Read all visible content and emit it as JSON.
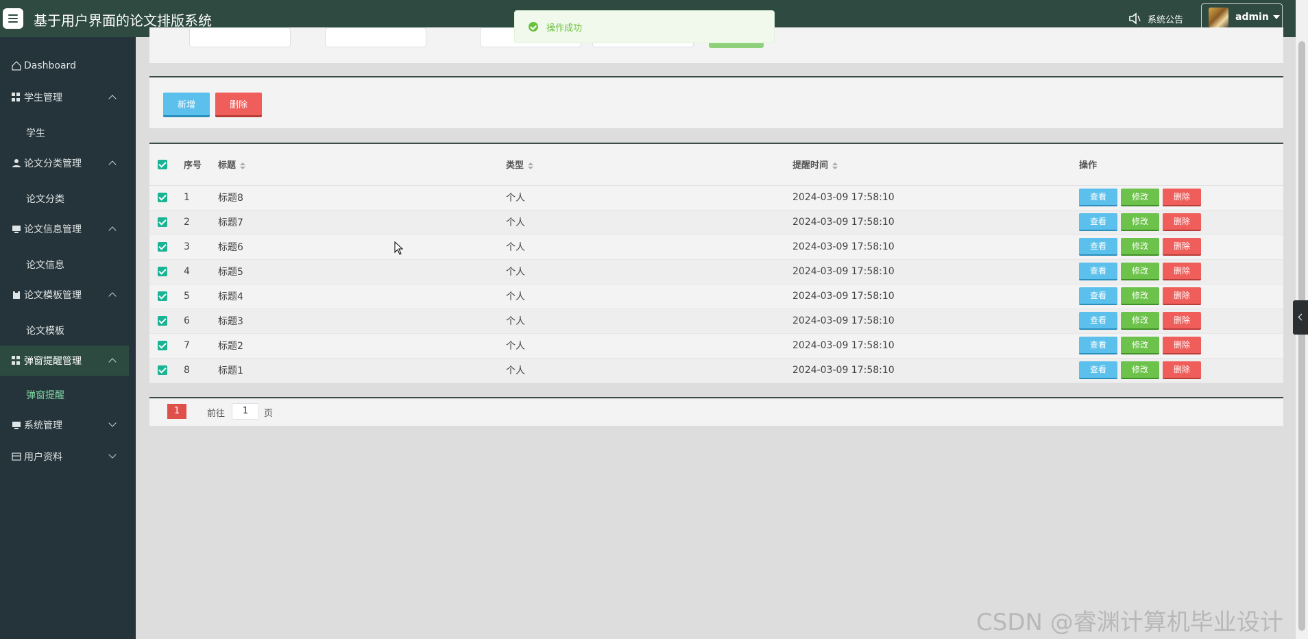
{
  "app": {
    "title": "基于用户界面的论文排版系统"
  },
  "header": {
    "notice_label": "系统公告",
    "user_name": "admin"
  },
  "toast": {
    "message": "操作成功"
  },
  "sidebar": {
    "dashboard": "Dashboard",
    "groups": [
      {
        "label": "学生管理",
        "sub": "学生"
      },
      {
        "label": "论文分类管理",
        "sub": "论文分类"
      },
      {
        "label": "论文信息管理",
        "sub": "论文信息"
      },
      {
        "label": "论文模板管理",
        "sub": "论文模板"
      },
      {
        "label": "弹窗提醒管理",
        "sub": "弹窗提醒"
      }
    ],
    "system": "系统管理",
    "profile": "用户资料"
  },
  "actions": {
    "add": "新增",
    "delete": "删除"
  },
  "table": {
    "headers": {
      "index": "序号",
      "title": "标题",
      "type": "类型",
      "time": "提醒时间",
      "ops": "操作"
    },
    "op_labels": {
      "view": "查看",
      "edit": "修改",
      "delete": "删除"
    },
    "rows": [
      {
        "index": "1",
        "title": "标题8",
        "type": "个人",
        "time": "2024-03-09 17:58:10"
      },
      {
        "index": "2",
        "title": "标题7",
        "type": "个人",
        "time": "2024-03-09 17:58:10"
      },
      {
        "index": "3",
        "title": "标题6",
        "type": "个人",
        "time": "2024-03-09 17:58:10"
      },
      {
        "index": "4",
        "title": "标题5",
        "type": "个人",
        "time": "2024-03-09 17:58:10"
      },
      {
        "index": "5",
        "title": "标题4",
        "type": "个人",
        "time": "2024-03-09 17:58:10"
      },
      {
        "index": "6",
        "title": "标题3",
        "type": "个人",
        "time": "2024-03-09 17:58:10"
      },
      {
        "index": "7",
        "title": "标题2",
        "type": "个人",
        "time": "2024-03-09 17:58:10"
      },
      {
        "index": "8",
        "title": "标题1",
        "type": "个人",
        "time": "2024-03-09 17:58:10"
      }
    ]
  },
  "pager": {
    "current": "1",
    "goto_label": "前往",
    "page_input": "1",
    "page_suffix": "页"
  },
  "watermark": "CSDN @睿渊计算机毕业设计",
  "colors": {
    "header_bg": "#2e4a41",
    "sidebar_bg": "#25333a",
    "accent_green": "#1ab394",
    "view_blue": "#5bc0eb",
    "edit_green": "#6cc24a",
    "delete_red": "#ef5e5a"
  }
}
